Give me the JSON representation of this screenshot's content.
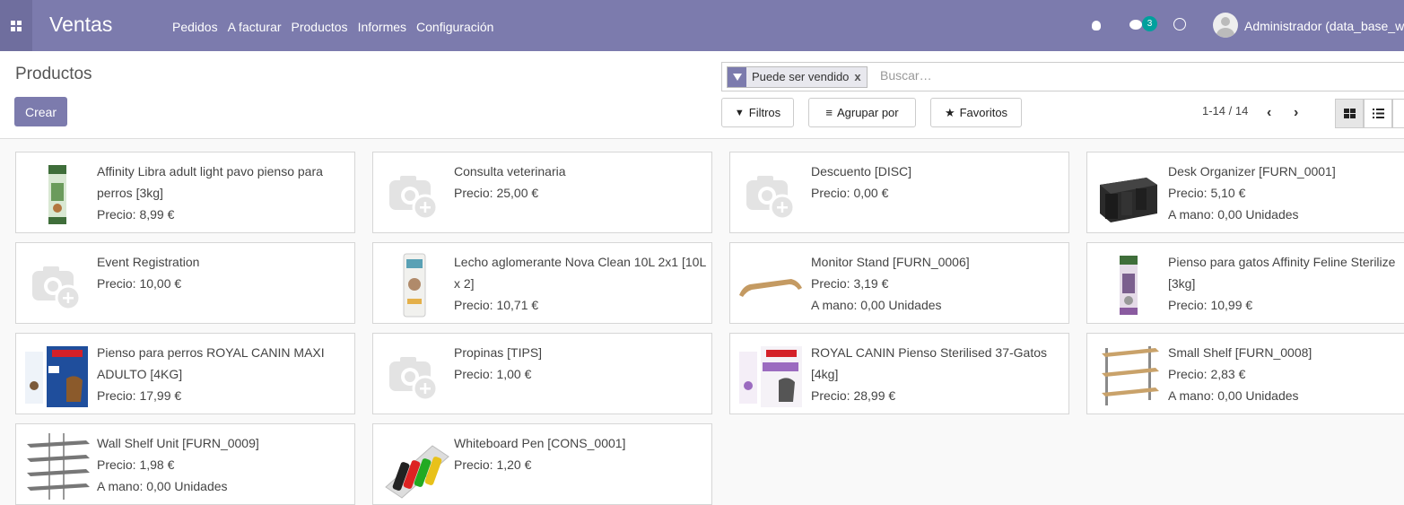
{
  "topbar": {
    "app_name": "Ventas",
    "menu": [
      "Pedidos",
      "A facturar",
      "Productos",
      "Informes",
      "Configuración"
    ],
    "chat_count": "3",
    "user": "Administrador (data_base_w"
  },
  "control_panel": {
    "title": "Productos",
    "create_label": "Crear",
    "facet_label": "Puede ser vendido",
    "facet_remove": "x",
    "search_placeholder": "Buscar…",
    "filters_label": "Filtros",
    "group_label": "Agrupar por",
    "favorites_label": "Favoritos",
    "pager": "1-14 / 14"
  },
  "colors": {
    "primary": "#7c7bad",
    "badge": "#00a09d"
  },
  "products": [
    {
      "name": "Affinity Libra adult light pavo pienso para perros [3kg]",
      "price": "Precio: 8,99 €",
      "stock": "",
      "image": "dog-food-bag"
    },
    {
      "name": "Consulta veterinaria",
      "price": "Precio: 25,00 €",
      "stock": "",
      "image": "placeholder-camera"
    },
    {
      "name": "Descuento [DISC]",
      "price": "Precio: 0,00 €",
      "stock": "",
      "image": "placeholder-camera"
    },
    {
      "name": "Desk Organizer [FURN_0001]",
      "price": "Precio: 5,10 €",
      "stock": "A mano: 0,00 Unidades",
      "image": "desk-organizer"
    },
    {
      "name": "Event Registration",
      "price": "Precio: 10,00 €",
      "stock": "",
      "image": "placeholder-camera"
    },
    {
      "name": "Lecho aglomerante Nova Clean 10L 2x1 [10L x 2]",
      "price": "Precio: 10,71 €",
      "stock": "",
      "image": "litter-bag"
    },
    {
      "name": "Monitor Stand [FURN_0006]",
      "price": "Precio: 3,19 €",
      "stock": "A mano: 0,00 Unidades",
      "image": "monitor-stand"
    },
    {
      "name": "Pienso para gatos Affinity Feline Sterilize [3kg]",
      "price": "Precio: 10,99 €",
      "stock": "",
      "image": "cat-food-bag"
    },
    {
      "name": "Pienso para perros ROYAL CANIN MAXI ADULTO [4KG]",
      "price": "Precio: 17,99 €",
      "stock": "",
      "image": "royal-canin-dog"
    },
    {
      "name": "Propinas [TIPS]",
      "price": "Precio: 1,00 €",
      "stock": "",
      "image": "placeholder-camera"
    },
    {
      "name": "ROYAL CANIN Pienso Sterilised 37-Gatos [4kg]",
      "price": "Precio: 28,99 €",
      "stock": "",
      "image": "royal-canin-cat"
    },
    {
      "name": "Small Shelf [FURN_0008]",
      "price": "Precio: 2,83 €",
      "stock": "A mano: 0,00 Unidades",
      "image": "small-shelf"
    },
    {
      "name": "Wall Shelf Unit [FURN_0009]",
      "price": "Precio: 1,98 €",
      "stock": "A mano: 0,00 Unidades",
      "image": "wall-shelf"
    },
    {
      "name": "Whiteboard Pen [CONS_0001]",
      "price": "Precio: 1,20 €",
      "stock": "",
      "image": "markers"
    }
  ]
}
